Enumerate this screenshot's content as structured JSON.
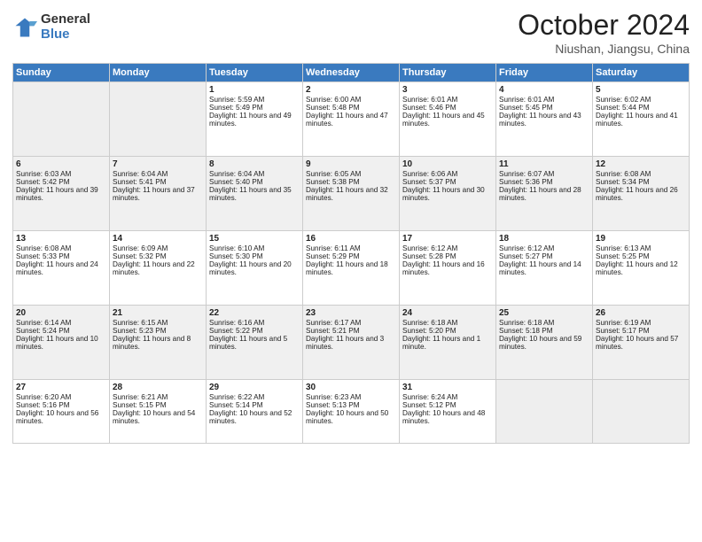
{
  "logo": {
    "general": "General",
    "blue": "Blue"
  },
  "title": "October 2024",
  "location": "Niushan, Jiangsu, China",
  "weekdays": [
    "Sunday",
    "Monday",
    "Tuesday",
    "Wednesday",
    "Thursday",
    "Friday",
    "Saturday"
  ],
  "weeks": [
    [
      {
        "day": "",
        "info": ""
      },
      {
        "day": "",
        "info": ""
      },
      {
        "day": "1",
        "info": "Sunrise: 5:59 AM\nSunset: 5:49 PM\nDaylight: 11 hours and 49 minutes."
      },
      {
        "day": "2",
        "info": "Sunrise: 6:00 AM\nSunset: 5:48 PM\nDaylight: 11 hours and 47 minutes."
      },
      {
        "day": "3",
        "info": "Sunrise: 6:01 AM\nSunset: 5:46 PM\nDaylight: 11 hours and 45 minutes."
      },
      {
        "day": "4",
        "info": "Sunrise: 6:01 AM\nSunset: 5:45 PM\nDaylight: 11 hours and 43 minutes."
      },
      {
        "day": "5",
        "info": "Sunrise: 6:02 AM\nSunset: 5:44 PM\nDaylight: 11 hours and 41 minutes."
      }
    ],
    [
      {
        "day": "6",
        "info": "Sunrise: 6:03 AM\nSunset: 5:42 PM\nDaylight: 11 hours and 39 minutes."
      },
      {
        "day": "7",
        "info": "Sunrise: 6:04 AM\nSunset: 5:41 PM\nDaylight: 11 hours and 37 minutes."
      },
      {
        "day": "8",
        "info": "Sunrise: 6:04 AM\nSunset: 5:40 PM\nDaylight: 11 hours and 35 minutes."
      },
      {
        "day": "9",
        "info": "Sunrise: 6:05 AM\nSunset: 5:38 PM\nDaylight: 11 hours and 32 minutes."
      },
      {
        "day": "10",
        "info": "Sunrise: 6:06 AM\nSunset: 5:37 PM\nDaylight: 11 hours and 30 minutes."
      },
      {
        "day": "11",
        "info": "Sunrise: 6:07 AM\nSunset: 5:36 PM\nDaylight: 11 hours and 28 minutes."
      },
      {
        "day": "12",
        "info": "Sunrise: 6:08 AM\nSunset: 5:34 PM\nDaylight: 11 hours and 26 minutes."
      }
    ],
    [
      {
        "day": "13",
        "info": "Sunrise: 6:08 AM\nSunset: 5:33 PM\nDaylight: 11 hours and 24 minutes."
      },
      {
        "day": "14",
        "info": "Sunrise: 6:09 AM\nSunset: 5:32 PM\nDaylight: 11 hours and 22 minutes."
      },
      {
        "day": "15",
        "info": "Sunrise: 6:10 AM\nSunset: 5:30 PM\nDaylight: 11 hours and 20 minutes."
      },
      {
        "day": "16",
        "info": "Sunrise: 6:11 AM\nSunset: 5:29 PM\nDaylight: 11 hours and 18 minutes."
      },
      {
        "day": "17",
        "info": "Sunrise: 6:12 AM\nSunset: 5:28 PM\nDaylight: 11 hours and 16 minutes."
      },
      {
        "day": "18",
        "info": "Sunrise: 6:12 AM\nSunset: 5:27 PM\nDaylight: 11 hours and 14 minutes."
      },
      {
        "day": "19",
        "info": "Sunrise: 6:13 AM\nSunset: 5:25 PM\nDaylight: 11 hours and 12 minutes."
      }
    ],
    [
      {
        "day": "20",
        "info": "Sunrise: 6:14 AM\nSunset: 5:24 PM\nDaylight: 11 hours and 10 minutes."
      },
      {
        "day": "21",
        "info": "Sunrise: 6:15 AM\nSunset: 5:23 PM\nDaylight: 11 hours and 8 minutes."
      },
      {
        "day": "22",
        "info": "Sunrise: 6:16 AM\nSunset: 5:22 PM\nDaylight: 11 hours and 5 minutes."
      },
      {
        "day": "23",
        "info": "Sunrise: 6:17 AM\nSunset: 5:21 PM\nDaylight: 11 hours and 3 minutes."
      },
      {
        "day": "24",
        "info": "Sunrise: 6:18 AM\nSunset: 5:20 PM\nDaylight: 11 hours and 1 minute."
      },
      {
        "day": "25",
        "info": "Sunrise: 6:18 AM\nSunset: 5:18 PM\nDaylight: 10 hours and 59 minutes."
      },
      {
        "day": "26",
        "info": "Sunrise: 6:19 AM\nSunset: 5:17 PM\nDaylight: 10 hours and 57 minutes."
      }
    ],
    [
      {
        "day": "27",
        "info": "Sunrise: 6:20 AM\nSunset: 5:16 PM\nDaylight: 10 hours and 56 minutes."
      },
      {
        "day": "28",
        "info": "Sunrise: 6:21 AM\nSunset: 5:15 PM\nDaylight: 10 hours and 54 minutes."
      },
      {
        "day": "29",
        "info": "Sunrise: 6:22 AM\nSunset: 5:14 PM\nDaylight: 10 hours and 52 minutes."
      },
      {
        "day": "30",
        "info": "Sunrise: 6:23 AM\nSunset: 5:13 PM\nDaylight: 10 hours and 50 minutes."
      },
      {
        "day": "31",
        "info": "Sunrise: 6:24 AM\nSunset: 5:12 PM\nDaylight: 10 hours and 48 minutes."
      },
      {
        "day": "",
        "info": ""
      },
      {
        "day": "",
        "info": ""
      }
    ]
  ]
}
